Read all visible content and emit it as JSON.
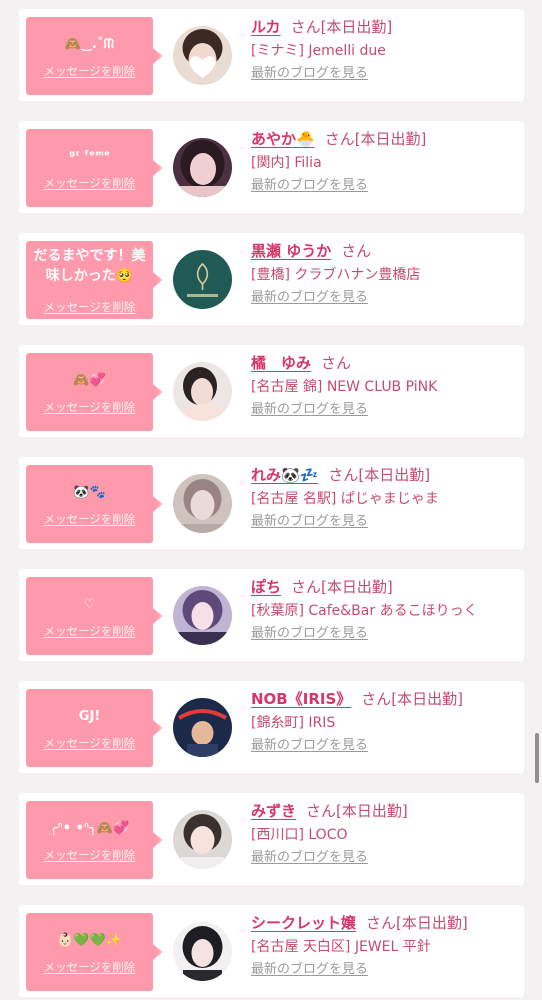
{
  "common": {
    "san": "さん",
    "delete_label": "メッセージを削除",
    "blog_link": "最新のブログを見る"
  },
  "cards": [
    {
      "message": "🙈‿.˚ᙏ",
      "name": "ルカ",
      "status": "[本日出勤]",
      "shop": "[ミナミ] Jemelli due",
      "avatar_color": "#3b2a24"
    },
    {
      "message": "ᵍᶦ ᶠᵉᵐᵉ",
      "name": "あやか🐣",
      "status": "[本日出勤]",
      "shop": "[関内] Filia",
      "avatar_color": "#3a2530"
    },
    {
      "message": "だるまやです！美味しかった🥺",
      "name": "黒瀬 ゆうか",
      "status": "",
      "shop": "[豊橋] クラブハナン豊橋店",
      "avatar_color": "#1f5a55"
    },
    {
      "message": "🙈💞",
      "name": "橘　ゆみ",
      "status": "",
      "shop": "[名古屋 錦] NEW CLUB PiNK",
      "avatar_color": "#e8e0dd"
    },
    {
      "message": "🐼🐾",
      "name": "れみ🐼💤",
      "status": "[本日出勤]",
      "shop": "[名古屋 名駅] ぱじゃまじゃま",
      "avatar_color": "#c9b8b4"
    },
    {
      "message": "♡",
      "name": "ぽち",
      "status": "[本日出勤]",
      "shop": "[秋葉原] Cafe&Bar あるこほりっく",
      "avatar_color": "#8a7aa8"
    },
    {
      "message": "GJ!",
      "name": "NOB《IRIS》",
      "status": "[本日出勤]",
      "shop": "[錦糸町] IRIS",
      "avatar_color": "#1c2a4a"
    },
    {
      "message": "╭ᐢ•  •ᐢ╮🙈💞",
      "name": "みずき",
      "status": "[本日出勤]",
      "shop": "[西川口] LOCO",
      "avatar_color": "#d8d4d2"
    },
    {
      "message": "👶🏻💚💚✨",
      "name": "シークレット嬢",
      "status": "[本日出勤]",
      "shop": "[名古屋 天白区] JEWEL 平針",
      "avatar_color": "#2a2a2e"
    }
  ]
}
